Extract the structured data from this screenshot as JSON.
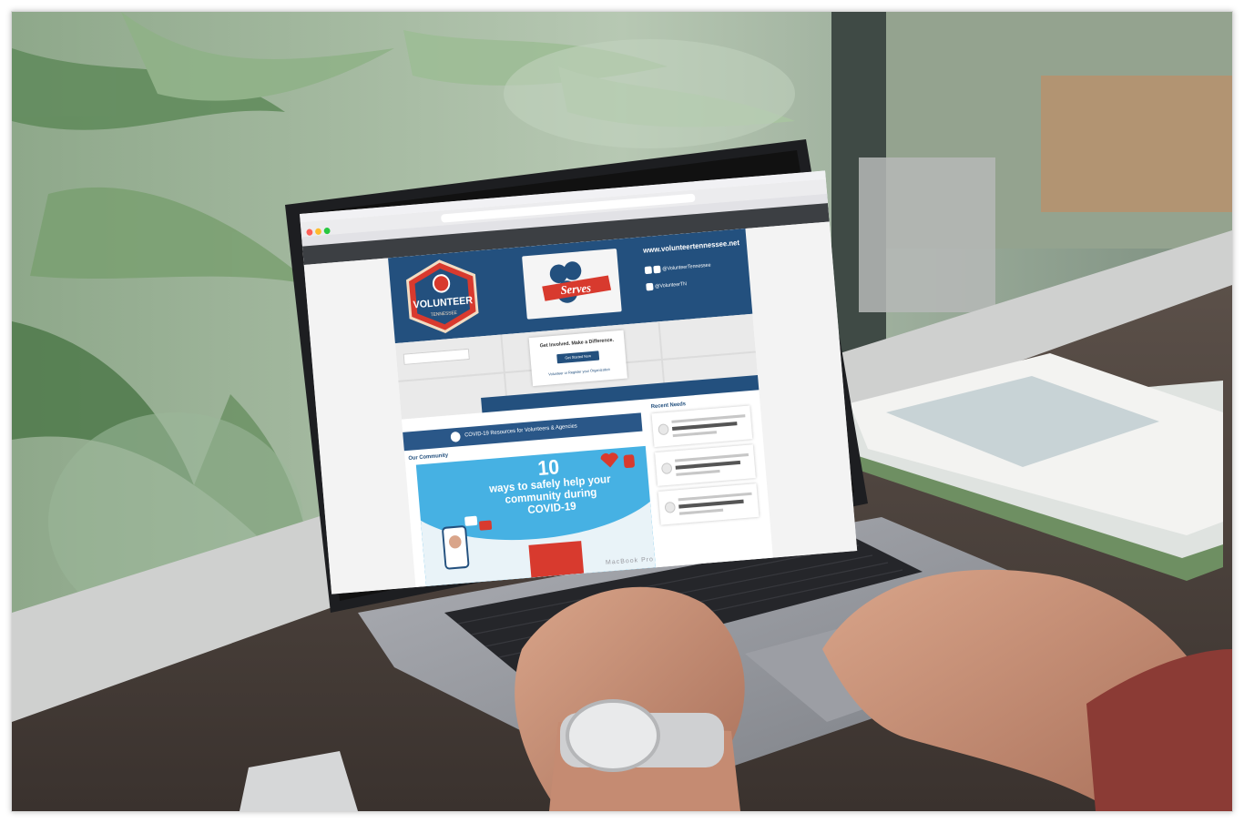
{
  "photo": {
    "description_tags": [
      "laptop",
      "hands",
      "wristwatch",
      "magazines",
      "window",
      "plants"
    ]
  },
  "laptop": {
    "brand": "MacBook Pro"
  },
  "website": {
    "header": {
      "logo_text": "VOLUNTEER",
      "logo_subtext": "TENNESSEE",
      "serves_logo_text": "Serves",
      "site_url": "www.volunteertennessee.net",
      "social_instagram_facebook": "@VolunteerTennessee",
      "social_twitter": "@VolunteerTN"
    },
    "map": {
      "cta_title": "Get Involved. Make a Difference.",
      "cta_button": "Get Started Now",
      "cta_link": "Volunteer or Register your Organization"
    },
    "covid_banner": "COVID-19 Resources for Volunteers & Agencies",
    "community_label": "Our Community",
    "covid_graphic": {
      "number": "10",
      "headline": "ways to safely help your community during COVID-19"
    },
    "recent_label": "Recent Needs"
  },
  "colors": {
    "brand_blue": "#23507e",
    "banner_blue": "#2a5788",
    "graphic_blue": "#46b1e3",
    "accent_red": "#d83a2e"
  }
}
